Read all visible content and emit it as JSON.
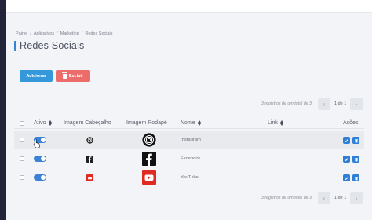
{
  "breadcrumb": [
    "Painel",
    "Aplicativos",
    "Marketing",
    "Redes Sociais"
  ],
  "page_title": "Redes Sociais",
  "buttons": {
    "add": "Adicionar",
    "delete": "Excluir"
  },
  "pagination": {
    "info": "3 registros de um total de 3",
    "page": "1 de 1"
  },
  "columns": {
    "ativo": "Ativo",
    "imagem_cabecalho": "Imagem Cabeçalho",
    "imagem_rodape": "Imagem Rodapé",
    "nome": "Nome",
    "link": "Link",
    "acoes": "Ações"
  },
  "rows": [
    {
      "active": true,
      "name": "Instagram",
      "icon": "instagram-icon"
    },
    {
      "active": true,
      "name": "Facebook",
      "icon": "facebook-icon"
    },
    {
      "active": true,
      "name": "YouTube",
      "icon": "youtube-icon"
    }
  ],
  "colors": {
    "accent": "#3498db",
    "danger": "#ec6c6c",
    "toggle": "#3b82d6",
    "sidebar": "#22253a"
  }
}
